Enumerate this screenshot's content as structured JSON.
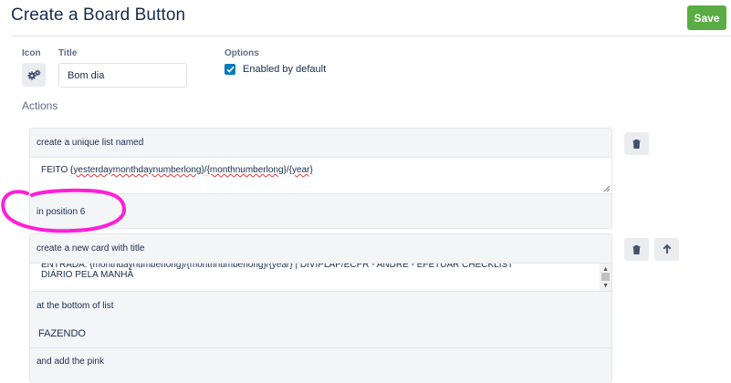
{
  "header": {
    "title": "Create a Board Button",
    "save_label": "Save"
  },
  "form": {
    "icon_label": "Icon",
    "icon_name": "gears-icon",
    "title_label": "Title",
    "title_value": "Bom dia",
    "options_label": "Options",
    "enabled_label": "Enabled by default",
    "enabled_checked": true
  },
  "actions": {
    "heading": "Actions",
    "action1": {
      "prefix": "create a unique list named",
      "name_parts": [
        "FEITO ",
        "{yesterdaymonthdaynumberlong}",
        "/",
        "{monthnumberlong}",
        "/",
        "{year}"
      ],
      "suffix": "in position 6"
    },
    "action2": {
      "prefix": "create a new card with title",
      "title_line1": "ENTRADA: {monthdaynumberlong}/{monthnumberlong}/{year} | DIVIPLAP/ECPR - ANDRE - EFETUAR CHECKLIST",
      "title_line2": "DIÁRIO PELA MANHÃ",
      "list_position": "at the bottom of list",
      "list_name": "FAZENDO",
      "label_text": "and add the pink"
    }
  },
  "colors": {
    "save_green": "#5aac44",
    "checkbox_blue": "#0079bf",
    "annotation_magenta": "#ff1fd8"
  },
  "icons": [
    "gears-icon",
    "trash-icon",
    "arrow-up-icon",
    "check-icon"
  ]
}
